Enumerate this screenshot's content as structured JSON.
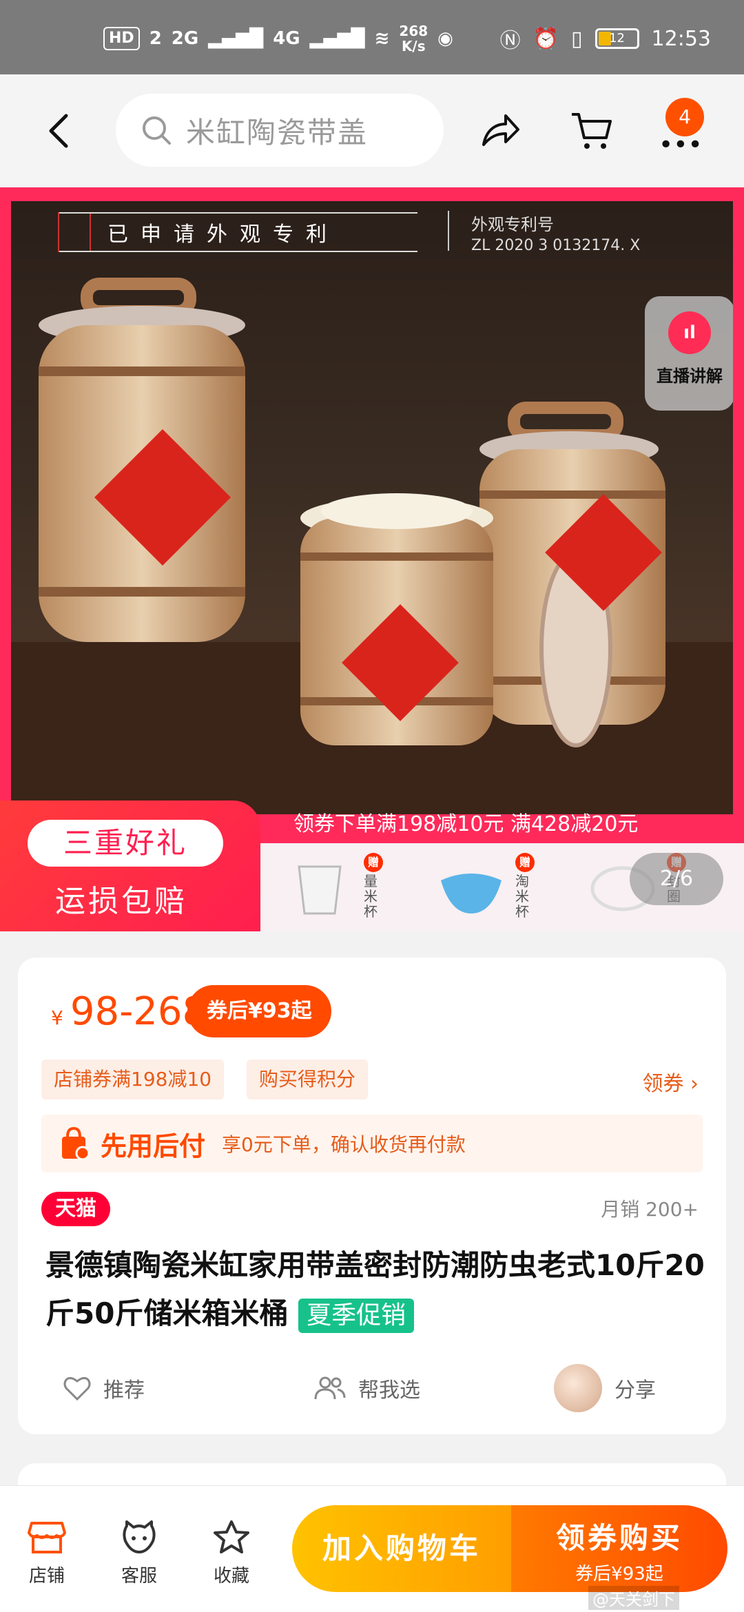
{
  "status_bar": {
    "hd": "HD",
    "sim": "2",
    "net1": "2G",
    "net2": "4G",
    "speed_value": "268",
    "speed_unit": "K/s",
    "battery": "12",
    "time": "12:53"
  },
  "nav": {
    "search_placeholder": "米缸陶瓷带盖",
    "cart_badge": "4"
  },
  "hero": {
    "patent_title": "已申请外观专利",
    "patent_label": "外观专利号",
    "patent_number": "ZL 2020 3 0132174. X",
    "live_label": "直播讲解",
    "promo_pill": "三重好礼",
    "promo_sub": "运损包赔",
    "promo_banner": "领券下单满198减10元 满428减20元",
    "gift_badge": "赠",
    "gifts": [
      "量米杯",
      "淘米杯",
      "封圈"
    ],
    "page_indicator": "2/6"
  },
  "product": {
    "currency": "¥",
    "price_range": "98-268",
    "coupon_price": "券后¥93起",
    "tag_store_coupon": "店铺券满198减10",
    "tag_points": "购买得积分",
    "get_coupon": "领券",
    "paylater_brand": "先用后付",
    "paylater_desc": "享0元下单，确认收货再付款",
    "tmall": "天猫",
    "monthly_sales": "月销 200+",
    "title": "景德镇陶瓷米缸家用带盖密封防潮防虫老式10斤20斤50斤储米箱米桶",
    "promo_badge": "夏季促销",
    "action_recommend": "推荐",
    "action_help": "帮我选",
    "action_share": "分享"
  },
  "bottom_bar": {
    "store": "店铺",
    "service": "客服",
    "favorite": "收藏",
    "add_cart": "加入购物车",
    "buy_label": "领券购买",
    "buy_sub": "券后¥93起"
  },
  "watermark": "@天关剑下",
  "colors": {
    "accent": "#ff4a00",
    "hero_frame": "#ff2a5a",
    "tmall_red": "#ff0036",
    "promo_green": "#17c28a"
  }
}
